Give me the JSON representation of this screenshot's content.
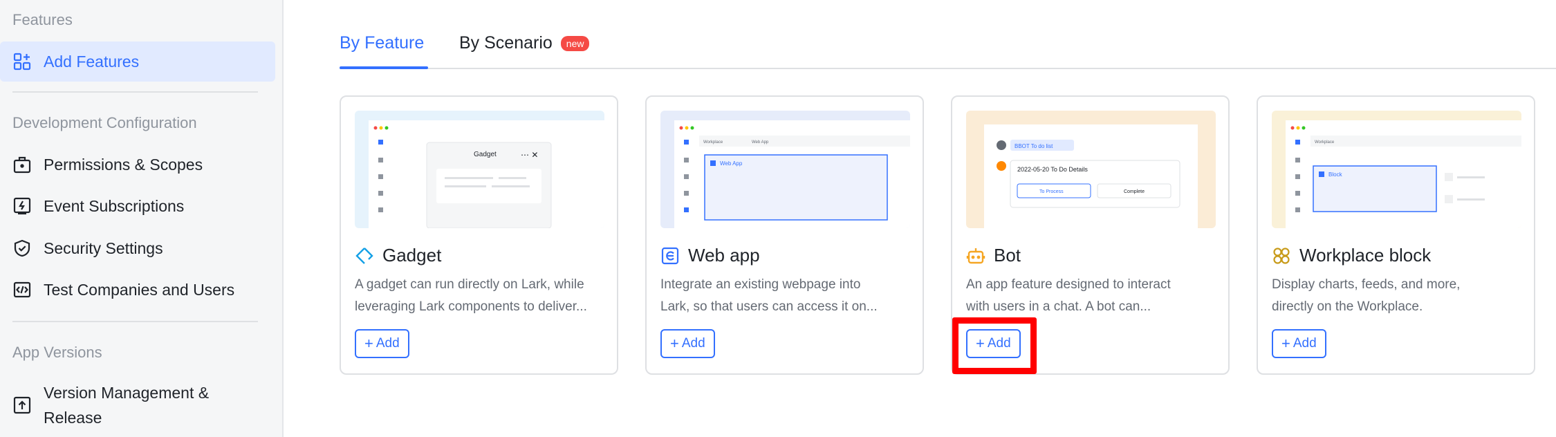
{
  "sidebar": {
    "sections": {
      "features": "Features",
      "dev_config": "Development Configuration",
      "app_versions": "App Versions"
    },
    "items": {
      "add_features": "Add Features",
      "permissions": "Permissions & Scopes",
      "events": "Event Subscriptions",
      "security": "Security Settings",
      "test_companies": "Test Companies and Users",
      "version_line1": "Version Management &",
      "version_line2": "Release"
    }
  },
  "tabs": {
    "by_feature": "By Feature",
    "by_scenario": "By Scenario",
    "new_badge": "new"
  },
  "cards": [
    {
      "title": "Gadget",
      "desc1": "A gadget can run directly on Lark, while",
      "desc2": "leveraging Lark components to deliver...",
      "add": "Add",
      "thumb_label": "Gadget",
      "thumb_color": "#e6f3fc"
    },
    {
      "title": "Web app",
      "desc1": "Integrate an existing webpage into",
      "desc2": "Lark, so that users can access it on...",
      "add": "Add",
      "thumb_label": "Web App",
      "thumb_tab1": "Workplace",
      "thumb_tab2": "Web App",
      "thumb_color": "#e6ecfa"
    },
    {
      "title": "Bot",
      "desc1": "An app feature designed to interact",
      "desc2": "with users in a chat. A bot can...",
      "add": "Add",
      "thumb_chip": "BBOT  To do list",
      "thumb_row": "2022-05-20 To Do Details",
      "thumb_btn1": "To Process",
      "thumb_btn2": "Complete",
      "thumb_color": "#fbecd6"
    },
    {
      "title": "Workplace block",
      "desc1": "Display charts, feeds, and more,",
      "desc2": "directly on the Workplace.",
      "add": "Add",
      "thumb_label": "Block",
      "thumb_tab1": "Workplace",
      "thumb_color": "#faf1d8"
    }
  ],
  "colors": {
    "accent": "#3370ff",
    "highlight": "#ff0000",
    "badge": "#f54a45"
  }
}
